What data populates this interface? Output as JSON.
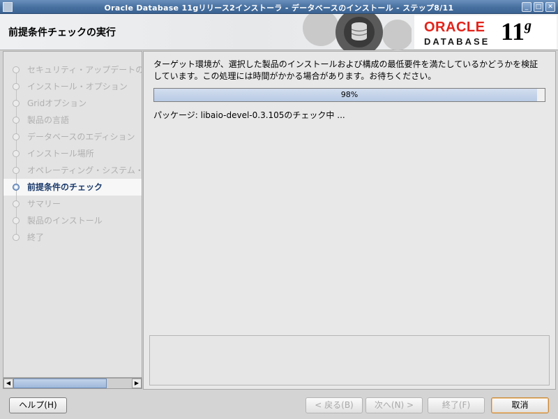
{
  "window": {
    "title": "Oracle Database 11gリリース2インストーラ - データベースのインストール - ステップ8/11"
  },
  "header": {
    "page_title": "前提条件チェックの実行",
    "logo": {
      "brand": "ORACLE",
      "product": "DATABASE",
      "version": "11",
      "version_suffix": "g"
    }
  },
  "steps": [
    {
      "label": "セキュリティ・アップデートの",
      "state": "done"
    },
    {
      "label": "インストール・オプション",
      "state": "done"
    },
    {
      "label": "Gridオプション",
      "state": "done"
    },
    {
      "label": "製品の言語",
      "state": "done"
    },
    {
      "label": "データベースのエディション",
      "state": "done"
    },
    {
      "label": "インストール場所",
      "state": "done"
    },
    {
      "label": "オペレーティング・システム・",
      "state": "done"
    },
    {
      "label": "前提条件のチェック",
      "state": "active"
    },
    {
      "label": "サマリー",
      "state": "pending"
    },
    {
      "label": "製品のインストール",
      "state": "pending"
    },
    {
      "label": "終了",
      "state": "pending"
    }
  ],
  "content": {
    "description": "ターゲット環境が、選択した製品のインストールおよび構成の最低要件を満たしているかどうかを検証しています。この処理には時間がかかる場合があります。お待ちください。",
    "progress_percent": 98,
    "progress_label": "98%",
    "status": "パッケージ: libaio-devel-0.3.105のチェック中 ..."
  },
  "buttons": {
    "help": "ヘルプ(H)",
    "back": "< 戻る(B)",
    "next": "次へ(N) >",
    "finish": "終了(F)",
    "cancel": "取消"
  },
  "colors": {
    "title_bar": "#47709f",
    "active_step": "#1a3a6b",
    "oracle_red": "#e2231a",
    "progress_fill": "#b8cae5"
  }
}
